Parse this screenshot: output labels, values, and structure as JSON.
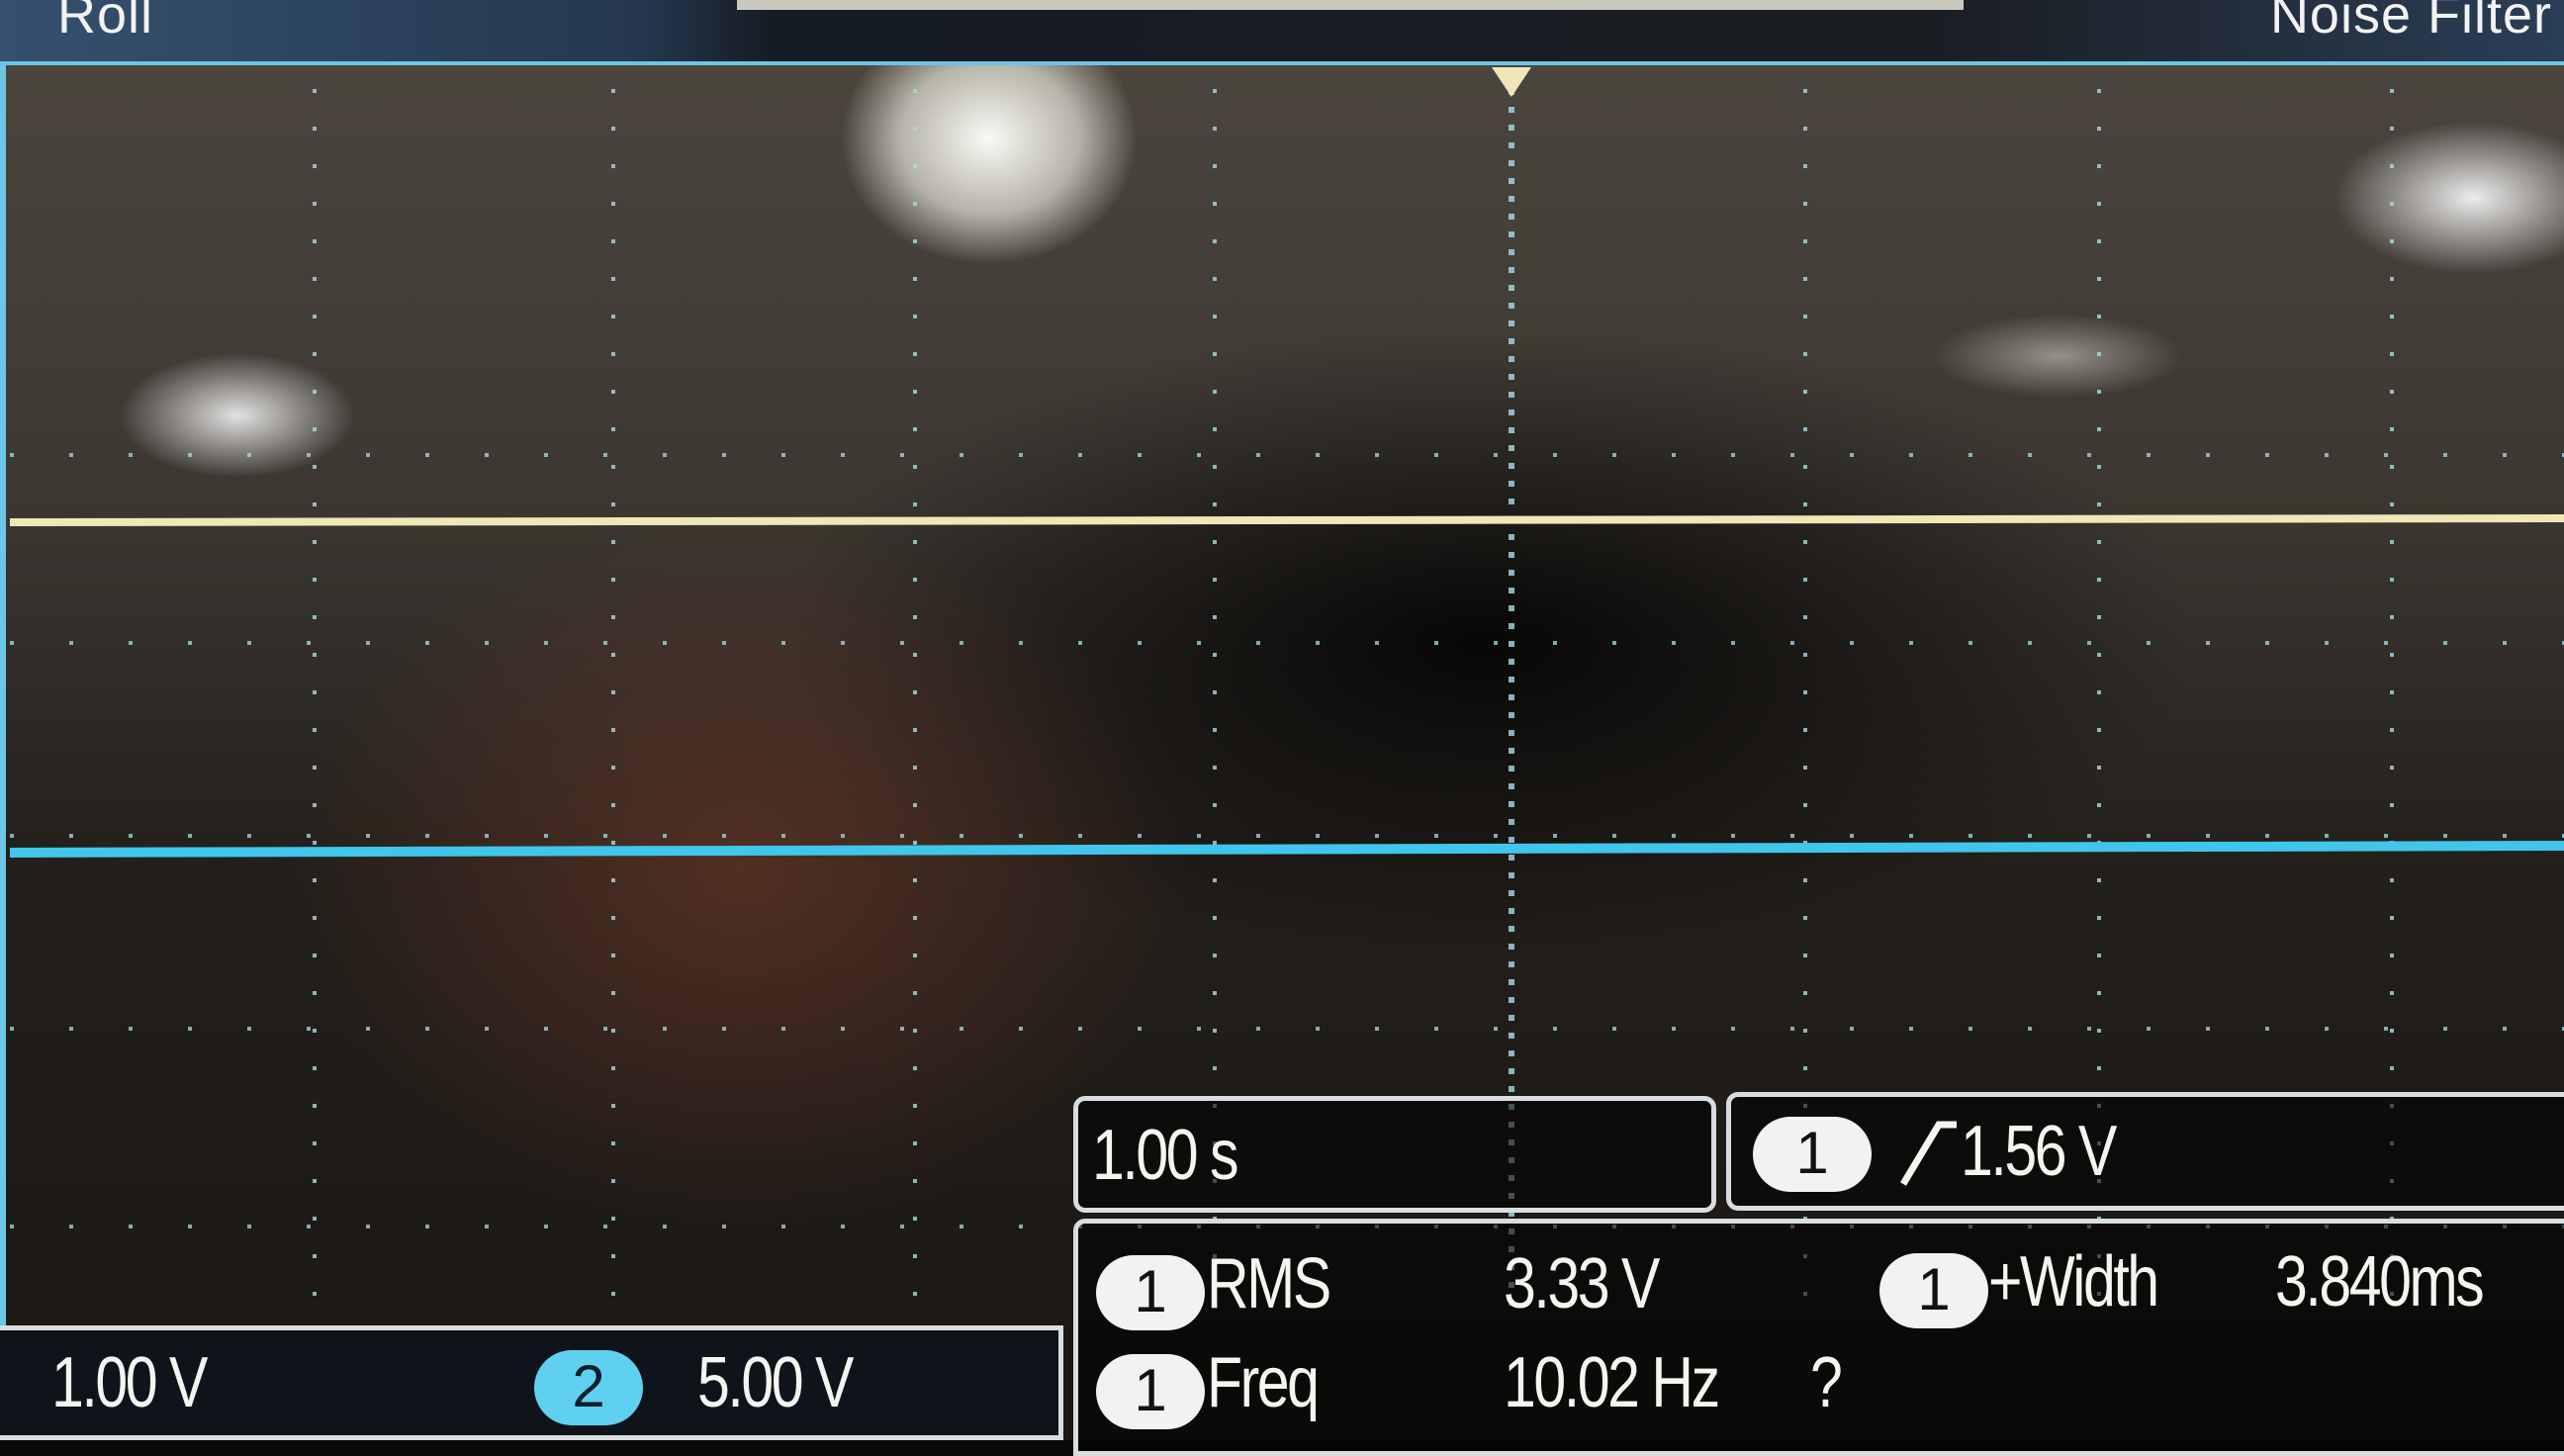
{
  "header": {
    "mode": "Roll",
    "noise_filter": "Noise Filter"
  },
  "timebase": {
    "value": "1.00 s"
  },
  "trigger": {
    "channel": "1",
    "level": "1.56 V"
  },
  "measurements": [
    {
      "channel": "1",
      "label": "RMS",
      "value": "3.33 V"
    },
    {
      "channel": "1",
      "label": "+Width",
      "value": "3.840ms"
    },
    {
      "channel": "1",
      "label": "Freq",
      "value": "10.02 Hz",
      "flag": "?"
    }
  ],
  "channels": {
    "ch1_scale": "1.00 V",
    "ch2_label": "2",
    "ch2_scale": "5.00 V"
  },
  "colors": {
    "ch1_trace": "#f0e7b8",
    "ch2_trace": "#3fc6ea",
    "frame": "#6cc6e6"
  }
}
